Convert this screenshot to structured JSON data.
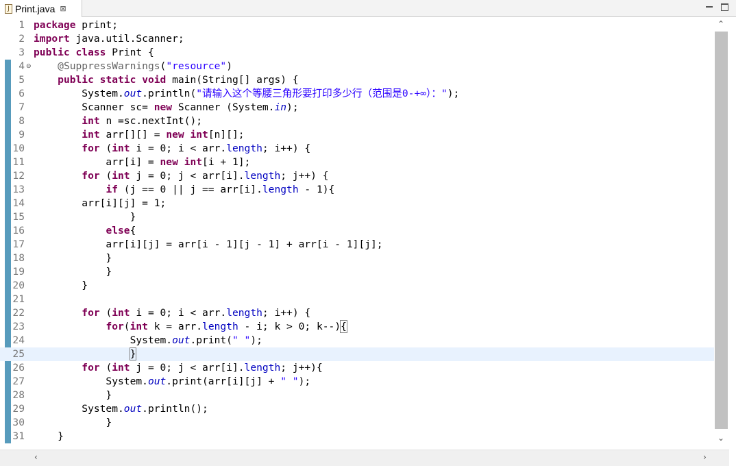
{
  "tab": {
    "title": "Print.java",
    "icon": "java-file-icon",
    "close": "⊠"
  },
  "editor": {
    "lines": [
      {
        "num": "1",
        "tokens": [
          {
            "t": "kw",
            "v": "package"
          },
          {
            "t": "p",
            "v": " print;"
          }
        ]
      },
      {
        "num": "2",
        "tokens": [
          {
            "t": "kw",
            "v": "import"
          },
          {
            "t": "p",
            "v": " java.util.Scanner;"
          }
        ]
      },
      {
        "num": "3",
        "tokens": [
          {
            "t": "kw",
            "v": "public"
          },
          {
            "t": "p",
            "v": " "
          },
          {
            "t": "kw",
            "v": "class"
          },
          {
            "t": "p",
            "v": " Print {"
          }
        ]
      },
      {
        "num": "4",
        "fold": "⊖",
        "tokens": [
          {
            "t": "p",
            "v": "    "
          },
          {
            "t": "ann",
            "v": "@SuppressWarnings"
          },
          {
            "t": "p",
            "v": "("
          },
          {
            "t": "str",
            "v": "\"resource\""
          },
          {
            "t": "p",
            "v": ")"
          }
        ]
      },
      {
        "num": "5",
        "tokens": [
          {
            "t": "p",
            "v": "    "
          },
          {
            "t": "kw",
            "v": "public"
          },
          {
            "t": "p",
            "v": " "
          },
          {
            "t": "kw",
            "v": "static"
          },
          {
            "t": "p",
            "v": " "
          },
          {
            "t": "kw",
            "v": "void"
          },
          {
            "t": "p",
            "v": " main(String[] args) {"
          }
        ]
      },
      {
        "num": "6",
        "tokens": [
          {
            "t": "p",
            "v": "        System."
          },
          {
            "t": "sfld",
            "v": "out"
          },
          {
            "t": "p",
            "v": ".println("
          },
          {
            "t": "str",
            "v": "\"请输入这个等腰三角形要打印多少行（范围是0-+∞）：\""
          },
          {
            "t": "p",
            "v": ");"
          }
        ]
      },
      {
        "num": "7",
        "tokens": [
          {
            "t": "p",
            "v": "        Scanner sc= "
          },
          {
            "t": "kw",
            "v": "new"
          },
          {
            "t": "p",
            "v": " Scanner (System."
          },
          {
            "t": "sfld",
            "v": "in"
          },
          {
            "t": "p",
            "v": ");"
          }
        ]
      },
      {
        "num": "8",
        "tokens": [
          {
            "t": "p",
            "v": "        "
          },
          {
            "t": "kw",
            "v": "int"
          },
          {
            "t": "p",
            "v": " n =sc.nextInt();"
          }
        ]
      },
      {
        "num": "9",
        "tokens": [
          {
            "t": "p",
            "v": "        "
          },
          {
            "t": "kw",
            "v": "int"
          },
          {
            "t": "p",
            "v": " arr[][] = "
          },
          {
            "t": "kw",
            "v": "new"
          },
          {
            "t": "p",
            "v": " "
          },
          {
            "t": "kw",
            "v": "int"
          },
          {
            "t": "p",
            "v": "[n][];"
          }
        ]
      },
      {
        "num": "10",
        "tokens": [
          {
            "t": "p",
            "v": "        "
          },
          {
            "t": "kw",
            "v": "for"
          },
          {
            "t": "p",
            "v": " ("
          },
          {
            "t": "kw",
            "v": "int"
          },
          {
            "t": "p",
            "v": " i = 0; i < arr."
          },
          {
            "t": "fld",
            "v": "length"
          },
          {
            "t": "p",
            "v": "; i++) {"
          }
        ]
      },
      {
        "num": "11",
        "tokens": [
          {
            "t": "p",
            "v": "            arr[i] = "
          },
          {
            "t": "kw",
            "v": "new"
          },
          {
            "t": "p",
            "v": " "
          },
          {
            "t": "kw",
            "v": "int"
          },
          {
            "t": "p",
            "v": "[i + 1];"
          }
        ]
      },
      {
        "num": "12",
        "tokens": [
          {
            "t": "p",
            "v": "        "
          },
          {
            "t": "kw",
            "v": "for"
          },
          {
            "t": "p",
            "v": " ("
          },
          {
            "t": "kw",
            "v": "int"
          },
          {
            "t": "p",
            "v": " j = 0; j < arr[i]."
          },
          {
            "t": "fld",
            "v": "length"
          },
          {
            "t": "p",
            "v": "; j++) {"
          }
        ]
      },
      {
        "num": "13",
        "tokens": [
          {
            "t": "p",
            "v": "            "
          },
          {
            "t": "kw",
            "v": "if"
          },
          {
            "t": "p",
            "v": " (j == 0 || j == arr[i]."
          },
          {
            "t": "fld",
            "v": "length"
          },
          {
            "t": "p",
            "v": " - 1){"
          }
        ]
      },
      {
        "num": "14",
        "tokens": [
          {
            "t": "p",
            "v": "        arr[i][j] = 1;"
          }
        ]
      },
      {
        "num": "15",
        "tokens": [
          {
            "t": "p",
            "v": "                }"
          }
        ]
      },
      {
        "num": "16",
        "tokens": [
          {
            "t": "p",
            "v": "            "
          },
          {
            "t": "kw",
            "v": "else"
          },
          {
            "t": "p",
            "v": "{"
          }
        ]
      },
      {
        "num": "17",
        "tokens": [
          {
            "t": "p",
            "v": "            arr[i][j] = arr[i - 1][j - 1] + arr[i - 1][j];"
          }
        ]
      },
      {
        "num": "18",
        "tokens": [
          {
            "t": "p",
            "v": "            }"
          }
        ]
      },
      {
        "num": "19",
        "tokens": [
          {
            "t": "p",
            "v": "            }"
          }
        ]
      },
      {
        "num": "20",
        "tokens": [
          {
            "t": "p",
            "v": "        }"
          }
        ]
      },
      {
        "num": "21",
        "tokens": []
      },
      {
        "num": "22",
        "tokens": [
          {
            "t": "p",
            "v": "        "
          },
          {
            "t": "kw",
            "v": "for"
          },
          {
            "t": "p",
            "v": " ("
          },
          {
            "t": "kw",
            "v": "int"
          },
          {
            "t": "p",
            "v": " i = 0; i < arr."
          },
          {
            "t": "fld",
            "v": "length"
          },
          {
            "t": "p",
            "v": "; i++) {"
          }
        ]
      },
      {
        "num": "23",
        "tokens": [
          {
            "t": "p",
            "v": "            "
          },
          {
            "t": "kw",
            "v": "for"
          },
          {
            "t": "p",
            "v": "("
          },
          {
            "t": "kw",
            "v": "int"
          },
          {
            "t": "p",
            "v": " k = arr."
          },
          {
            "t": "fld",
            "v": "length"
          },
          {
            "t": "p",
            "v": " - i; k > 0; k--)"
          },
          {
            "t": "bracket",
            "v": "{"
          }
        ]
      },
      {
        "num": "24",
        "tokens": [
          {
            "t": "p",
            "v": "                System."
          },
          {
            "t": "sfld",
            "v": "out"
          },
          {
            "t": "p",
            "v": ".print("
          },
          {
            "t": "str",
            "v": "\" \""
          },
          {
            "t": "p",
            "v": ");"
          }
        ]
      },
      {
        "num": "25",
        "current": true,
        "tokens": [
          {
            "t": "p",
            "v": "                "
          },
          {
            "t": "bracket",
            "v": "}"
          }
        ]
      },
      {
        "num": "26",
        "tokens": [
          {
            "t": "p",
            "v": "        "
          },
          {
            "t": "kw",
            "v": "for"
          },
          {
            "t": "p",
            "v": " ("
          },
          {
            "t": "kw",
            "v": "int"
          },
          {
            "t": "p",
            "v": " j = 0; j < arr[i]."
          },
          {
            "t": "fld",
            "v": "length"
          },
          {
            "t": "p",
            "v": "; j++){"
          }
        ]
      },
      {
        "num": "27",
        "tokens": [
          {
            "t": "p",
            "v": "            System."
          },
          {
            "t": "sfld",
            "v": "out"
          },
          {
            "t": "p",
            "v": ".print(arr[i][j] + "
          },
          {
            "t": "str",
            "v": "\" \""
          },
          {
            "t": "p",
            "v": ");"
          }
        ]
      },
      {
        "num": "28",
        "tokens": [
          {
            "t": "p",
            "v": "            }"
          }
        ]
      },
      {
        "num": "29",
        "tokens": [
          {
            "t": "p",
            "v": "        System."
          },
          {
            "t": "sfld",
            "v": "out"
          },
          {
            "t": "p",
            "v": ".println();"
          }
        ]
      },
      {
        "num": "30",
        "tokens": [
          {
            "t": "p",
            "v": "            }"
          }
        ]
      },
      {
        "num": "31",
        "tokens": [
          {
            "t": "p",
            "v": "    }"
          }
        ]
      }
    ]
  },
  "colors": {
    "keyword": "#7f0055",
    "string": "#2a00ff",
    "field": "#0000c0",
    "annotation": "#646464",
    "current_line": "#e8f2fe"
  },
  "scroll": {
    "up": "⌃",
    "down": "⌄",
    "left": "‹",
    "right": "›"
  }
}
